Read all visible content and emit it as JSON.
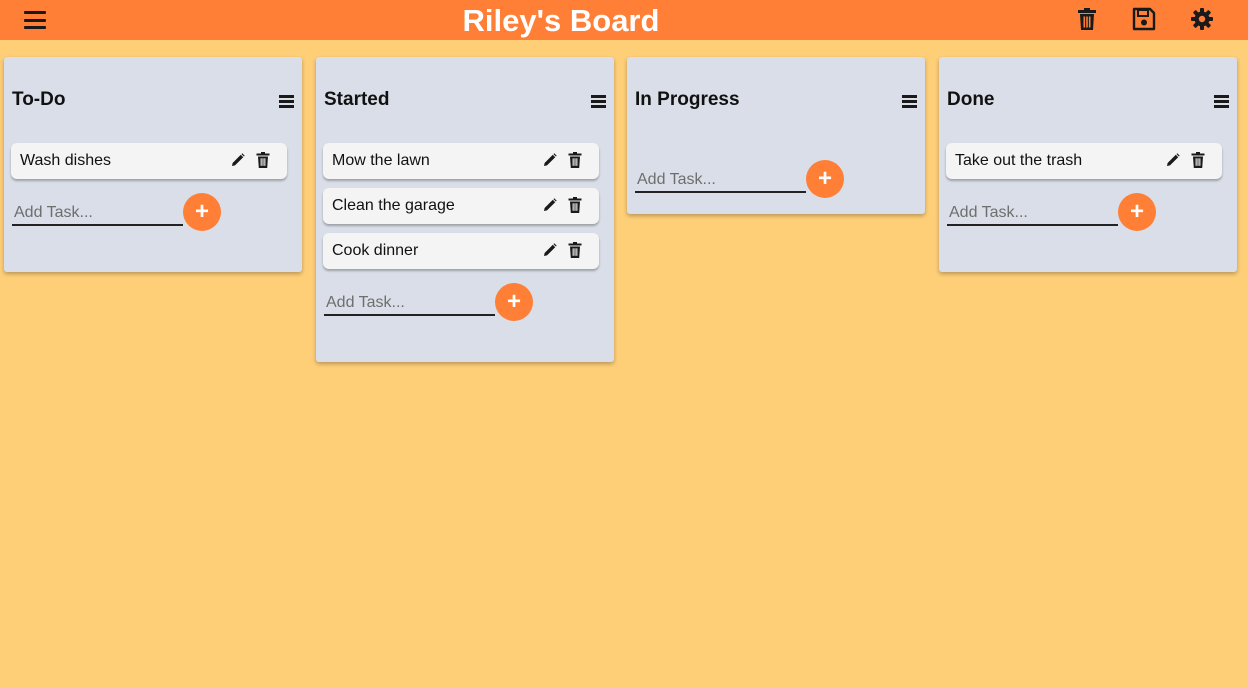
{
  "header": {
    "title": "Riley's Board",
    "menu_icon": "hamburger-icon",
    "actions": [
      "trash-icon",
      "save-icon",
      "settings-gear-icon"
    ],
    "bar_color": "#ff7f36"
  },
  "colors": {
    "background": "#ffcf78",
    "column": "#d9dee8",
    "accent": "#ff7f36",
    "card": "#f4f4f4"
  },
  "columns": [
    {
      "title": "To-Do",
      "tasks": [
        {
          "text": "Wash dishes"
        }
      ],
      "add_placeholder": "Add Task...",
      "add_label": "+"
    },
    {
      "title": "Started",
      "tasks": [
        {
          "text": "Mow the lawn"
        },
        {
          "text": "Clean the garage"
        },
        {
          "text": "Cook dinner"
        }
      ],
      "add_placeholder": "Add Task...",
      "add_label": "+"
    },
    {
      "title": "In Progress",
      "tasks": [],
      "add_placeholder": "Add Task...",
      "add_label": "+"
    },
    {
      "title": "Done",
      "tasks": [
        {
          "text": "Take out the trash"
        }
      ],
      "add_placeholder": "Add Task...",
      "add_label": "+"
    }
  ]
}
